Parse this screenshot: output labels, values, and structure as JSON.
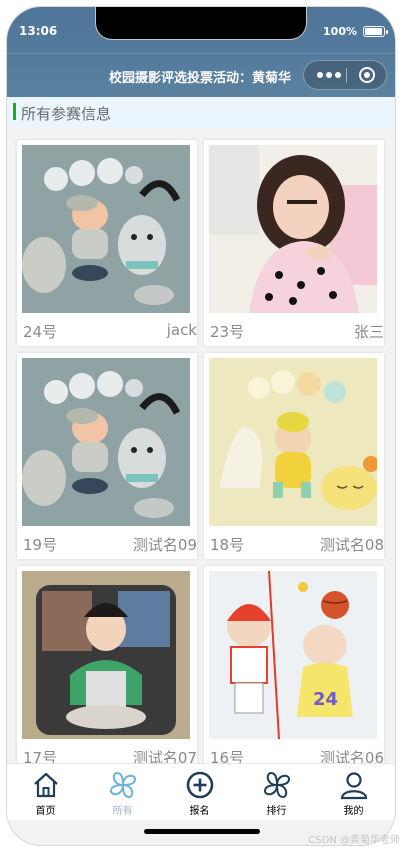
{
  "status": {
    "time": "13:06",
    "battery": "100%"
  },
  "nav": {
    "title": "校园摄影评选投票活动：黄菊华"
  },
  "section": {
    "title": "所有参赛信息"
  },
  "cards": [
    {
      "number": "24号",
      "name": "jack",
      "photo": "baby-100-days-elephant"
    },
    {
      "number": "23号",
      "name": "张三",
      "photo": "girl-polka-dot-dress"
    },
    {
      "number": "19号",
      "name": "测试名09",
      "photo": "baby-100-days-elephant"
    },
    {
      "number": "18号",
      "name": "测试名08",
      "photo": "baby-100-days-yellow"
    },
    {
      "number": "17号",
      "name": "测试名07",
      "photo": "boy-on-pillow"
    },
    {
      "number": "16号",
      "name": "测试名06",
      "photo": "basketball-cartoon-baby"
    }
  ],
  "tabs": [
    {
      "label": "首页",
      "icon": "home-icon",
      "active": false
    },
    {
      "label": "所有",
      "icon": "clover-icon",
      "active": true
    },
    {
      "label": "报名",
      "icon": "add-circle-icon",
      "active": false
    },
    {
      "label": "排行",
      "icon": "clover-icon",
      "active": false
    },
    {
      "label": "我的",
      "icon": "user-icon",
      "active": false
    }
  ],
  "watermark": "CSDN @黄菊华老师",
  "colors": {
    "header": "#557c9d",
    "section_bg": "#eaf5fd",
    "accent_bar": "#1aad19",
    "tab_active": "#a0b6c8",
    "icon_dark": "#1f3d5a"
  }
}
